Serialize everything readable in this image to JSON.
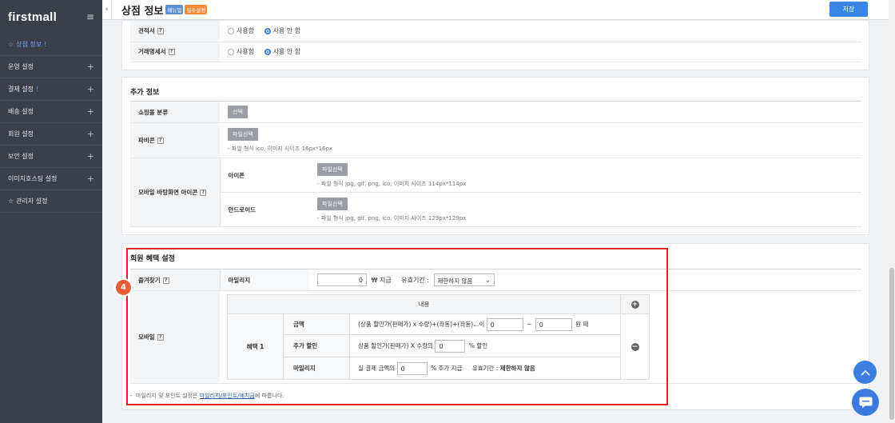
{
  "sidebar": {
    "logo": "firstmall",
    "toggle_icon": "≡",
    "items": [
      {
        "label": "상점 정보",
        "suffix": "!",
        "active": true,
        "star": true,
        "plus": false
      },
      {
        "label": "운영 설정",
        "suffix": "",
        "active": false,
        "star": false,
        "plus": true
      },
      {
        "label": "결제 설정",
        "suffix": "!",
        "active": false,
        "star": false,
        "plus": true
      },
      {
        "label": "배송 설정",
        "suffix": "",
        "active": false,
        "star": false,
        "plus": true
      },
      {
        "label": "회원 설정",
        "suffix": "",
        "active": false,
        "star": false,
        "plus": true
      },
      {
        "label": "보안 설정",
        "suffix": "",
        "active": false,
        "star": false,
        "plus": true
      },
      {
        "label": "이미지호스팅 설정",
        "suffix": "",
        "active": false,
        "star": false,
        "plus": true
      },
      {
        "label": "관리자 설정",
        "suffix": "",
        "active": false,
        "star": true,
        "plus": false
      }
    ]
  },
  "header": {
    "back_icon": "‹",
    "title": "상점 정보",
    "badge_manual": "매뉴얼",
    "badge_required": "필수설정",
    "save_label": "저장"
  },
  "doc_section": {
    "rows": [
      {
        "label": "견적서",
        "opt_use": "사용함",
        "opt_nouse": "사용 안 함",
        "selected": "nouse"
      },
      {
        "label": "거래명세서",
        "opt_use": "사용함",
        "opt_nouse": "사용 안 함",
        "selected": "nouse"
      }
    ]
  },
  "extra": {
    "title": "추가 정보",
    "category_label": "쇼핑몰 분류",
    "category_btn": "선택",
    "favicon_label": "파비콘",
    "favicon_btn": "파일선택",
    "favicon_hint": "- 파일 형식 ico, 이미지 사이즈 16px*16px",
    "mobile_label": "모바일 바탕화면 아이콘",
    "icon_label": "아이폰",
    "icon_btn": "파일선택",
    "icon_hint": "- 파일 형식 jpg, gif, png, ico, 이미지 사이즈 114px*114px",
    "android_label": "안드로이드",
    "android_btn": "파일선택",
    "android_hint": "- 파일 형식 jpg, gif, png, ico, 이미지 사이즈 129px*129px"
  },
  "benefit": {
    "title": "회원 혜택 설정",
    "step_number": "4",
    "fav_label": "즐겨찾기",
    "mileage_label": "마일리지",
    "mileage_value": "0",
    "mileage_unit": "₩ 지급",
    "validity_label": "유효기간 :",
    "validity_select": "제한하지 않음",
    "mobile_label": "모바일",
    "content_header": "내용",
    "benefit_name": "혜택 1",
    "row_amount_label": "금액",
    "row_amount_text": "(상품 할인가(판매가) x 수량)+(좌동)+(좌동)...이",
    "row_amount_from": "0",
    "row_amount_tilde": "~",
    "row_amount_to": "0",
    "row_amount_suffix": "원 때",
    "row_discount_label": "추가 할인",
    "row_discount_text": "상품 할인가(판매가) X 수량의",
    "row_discount_value": "0",
    "row_discount_suffix": "% 할인",
    "row_mileage_label": "마일리지",
    "row_mileage_text": "실 결제 금액의",
    "row_mileage_value": "0",
    "row_mileage_suffix": "% 추가 지급",
    "row_mileage_validity": "유효기간 :",
    "row_mileage_validity_value": "제한하지 않음",
    "footnote_prefix": "마일리지 및 포인트 설정은",
    "footnote_link": "마일리지/포인트/예치금",
    "footnote_suffix": "에 따릅니다."
  },
  "icons": {
    "plus": "+",
    "minus": "−",
    "help": "?",
    "up": "up-arrow-icon",
    "chat": "chat-icon"
  },
  "colors": {
    "sidebar_bg": "#3a3f48",
    "accent_blue": "#3a86e6",
    "highlight_red": "#e02424",
    "badge_orange": "#e85d35"
  }
}
